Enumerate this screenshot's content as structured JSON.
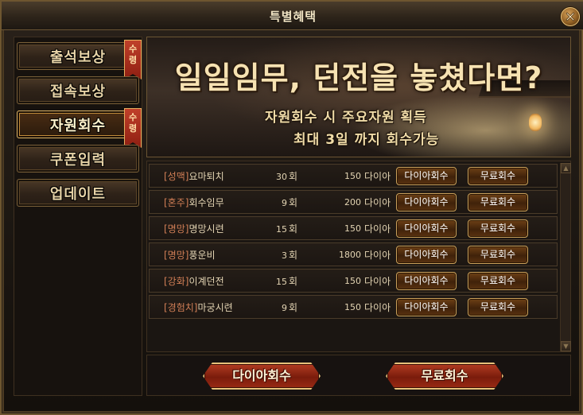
{
  "window": {
    "title": "특별혜택"
  },
  "sidebar": {
    "items": [
      {
        "label": "출석보상",
        "badge": [
          "수",
          "령"
        ],
        "active": false
      },
      {
        "label": "접속보상",
        "badge": null,
        "active": false
      },
      {
        "label": "자원회수",
        "badge": [
          "수",
          "령"
        ],
        "active": true
      },
      {
        "label": "쿠폰입력",
        "badge": null,
        "active": false
      },
      {
        "label": "업데이트",
        "badge": null,
        "active": false
      }
    ]
  },
  "banner": {
    "headline": "일일임무, 던전을 놓쳤다면?",
    "line1": "자원회수 시 주요자원 획득",
    "line2": "최대 3일 까지 회수가능"
  },
  "rows": [
    {
      "category": "[성맥]",
      "name": "요마퇴치",
      "count": "30",
      "unit": "회",
      "cost": "150",
      "currency": "다이아",
      "dia_label": "다이아회수",
      "free_label": "무료회수"
    },
    {
      "category": "[혼주]",
      "name": "회수임무",
      "count": "9",
      "unit": "회",
      "cost": "200",
      "currency": "다이아",
      "dia_label": "다이아회수",
      "free_label": "무료회수"
    },
    {
      "category": "[명망]",
      "name": "명망시련",
      "count": "15",
      "unit": "회",
      "cost": "150",
      "currency": "다이아",
      "dia_label": "다이아회수",
      "free_label": "무료회수"
    },
    {
      "category": "[명망]",
      "name": "풍운비",
      "count": "3",
      "unit": "회",
      "cost": "1800",
      "currency": "다이아",
      "dia_label": "다이아회수",
      "free_label": "무료회수"
    },
    {
      "category": "[강화]",
      "name": "이계던전",
      "count": "15",
      "unit": "회",
      "cost": "150",
      "currency": "다이아",
      "dia_label": "다이아회수",
      "free_label": "무료회수"
    },
    {
      "category": "[경험치]",
      "name": "마궁시련",
      "count": "9",
      "unit": "회",
      "cost": "150",
      "currency": "다이아",
      "dia_label": "다이아회수",
      "free_label": "무료회수"
    }
  ],
  "footer": {
    "dia_all_label": "다이아회수",
    "free_all_label": "무료회수"
  },
  "colors": {
    "accent_gold": "#caa05a",
    "category_text": "#d27f56",
    "badge_red": "#c0402a",
    "big_button_red": "#b23c22"
  }
}
